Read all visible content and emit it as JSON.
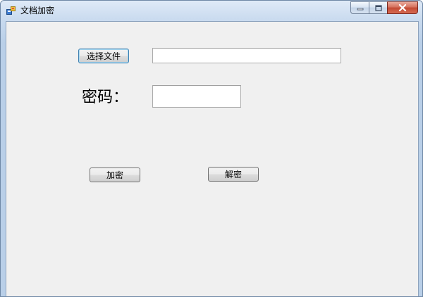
{
  "window": {
    "title": "文档加密"
  },
  "form": {
    "choose_file_label": "选择文件",
    "file_path_value": "",
    "password_label": "密码：",
    "password_value": "",
    "encrypt_label": "加密",
    "decrypt_label": "解密"
  },
  "icons": {
    "app": "app-icon",
    "minimize": "minimize-icon",
    "maximize": "maximize-icon",
    "close": "close-icon"
  },
  "colors": {
    "client_background": "#f0f0f0",
    "close_button": "#c34a33",
    "titlebar": "#c7d9ee"
  }
}
